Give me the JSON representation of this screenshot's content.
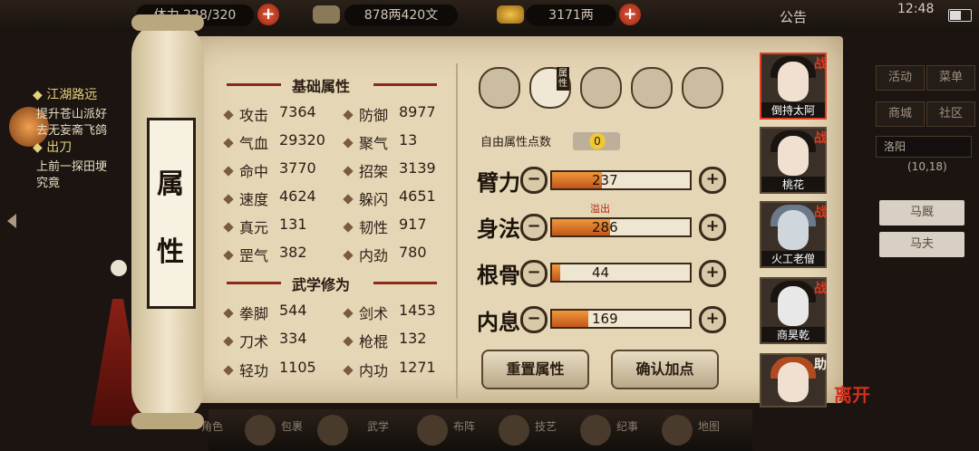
{
  "topbar": {
    "stamina": "体力 228/320",
    "copper": "878两420文",
    "silver": "3171两",
    "notice": "公告",
    "time": "12:48"
  },
  "quests": [
    "◆ 江湖路远",
    "提升苍山派好",
    "去无妄斋飞鸽",
    "◆ 出刀",
    "上前一探田埂",
    "究竟"
  ],
  "page_title": [
    "属",
    "性"
  ],
  "sections": {
    "basic": "基础属性",
    "martial": "武学修为"
  },
  "basic_stats": [
    {
      "l_label": "攻击",
      "l_value": "7364",
      "r_label": "防御",
      "r_value": "8977"
    },
    {
      "l_label": "气血",
      "l_value": "29320",
      "r_label": "聚气",
      "r_value": "13"
    },
    {
      "l_label": "命中",
      "l_value": "3770",
      "r_label": "招架",
      "r_value": "3139"
    },
    {
      "l_label": "速度",
      "l_value": "4624",
      "r_label": "躲闪",
      "r_value": "4651"
    },
    {
      "l_label": "真元",
      "l_value": "131",
      "r_label": "韧性",
      "r_value": "917"
    },
    {
      "l_label": "罡气",
      "l_value": "382",
      "r_label": "内劲",
      "r_value": "780"
    }
  ],
  "martial_stats": [
    {
      "l_label": "拳脚",
      "l_value": "544",
      "r_label": "剑术",
      "r_value": "1453"
    },
    {
      "l_label": "刀术",
      "l_value": "334",
      "r_label": "枪棍",
      "r_value": "132"
    },
    {
      "l_label": "轻功",
      "l_value": "1105",
      "r_label": "内功",
      "r_value": "1271"
    }
  ],
  "tabs": {
    "selected_label": "属性",
    "icons": [
      "hat-icon",
      "scroll-icon",
      "taiji-icon",
      "meridian-icon",
      "compass-icon"
    ]
  },
  "free_points": {
    "label": "自由属性点数",
    "value": "0"
  },
  "attributes": [
    {
      "label": "臂力",
      "value": "237",
      "fill": 0.36
    },
    {
      "label": "身法",
      "value": "286",
      "fill": 0.42,
      "note": "溢出"
    },
    {
      "label": "根骨",
      "value": "44",
      "fill": 0.06
    },
    {
      "label": "内息",
      "value": "169",
      "fill": 0.26
    }
  ],
  "buttons": {
    "reset": "重置属性",
    "confirm": "确认加点"
  },
  "characters": [
    {
      "name": "倒持太阿",
      "tag": "战"
    },
    {
      "name": "桃花",
      "tag": "战"
    },
    {
      "name": "火工老僧",
      "tag": "战"
    },
    {
      "name": "商昊乾",
      "tag": "战"
    },
    {
      "name": "",
      "tag": "助"
    }
  ],
  "leave": "离开",
  "right_menu": {
    "activity": "活动",
    "menu": "菜单",
    "shop": "商城",
    "community": "社区",
    "location": "洛阳",
    "coords": "(10,18)",
    "stable": "马厩",
    "groom": "马夫"
  },
  "bottom_bar": [
    "角色",
    "包裹",
    "武学",
    "布阵",
    "技艺",
    "纪事",
    "地图"
  ],
  "colors": {
    "parchment": "#e5d6b6",
    "bar_fill": "#e07a2a",
    "accent_red": "#d2301c"
  }
}
